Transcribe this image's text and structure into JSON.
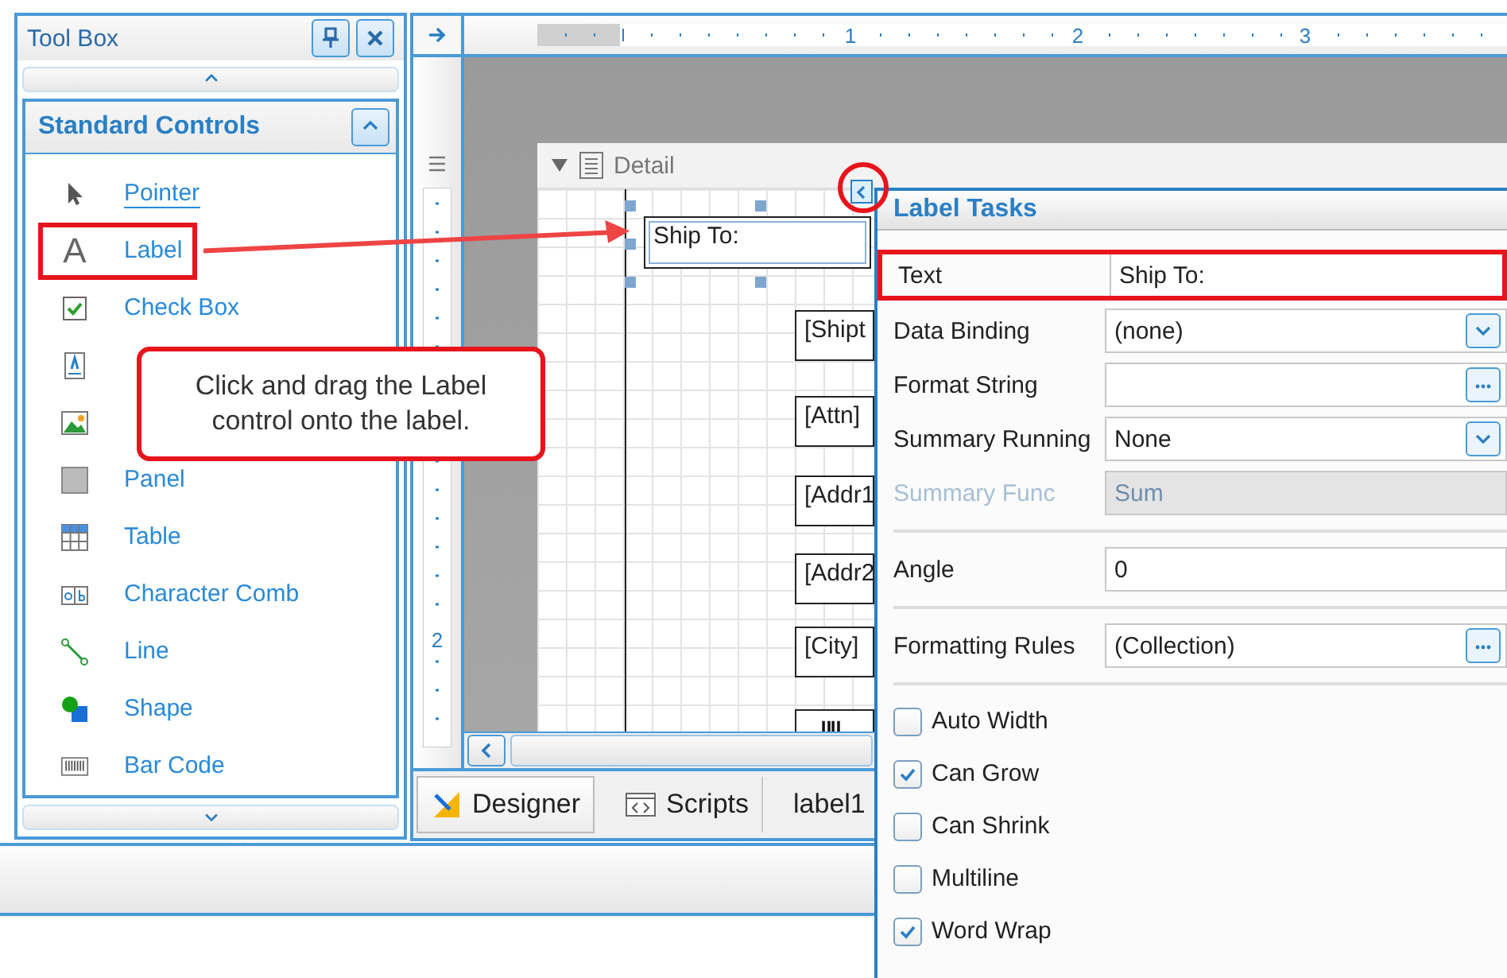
{
  "toolbox": {
    "title": "Tool Box",
    "group": {
      "title": "Standard Controls",
      "expanded": true,
      "items": [
        {
          "kind": "pointer",
          "label": "Pointer",
          "selected": true,
          "highlighted": false
        },
        {
          "kind": "label",
          "glyph": "A",
          "label": "Label",
          "selected": false,
          "highlighted": true
        },
        {
          "kind": "checkbox",
          "label": "Check Box",
          "selected": false,
          "highlighted": false
        },
        {
          "kind": "textbox"
        },
        {
          "kind": "picture"
        },
        {
          "kind": "panel",
          "label": "Panel",
          "selected": false,
          "highlighted": false
        },
        {
          "kind": "table",
          "label": "Table",
          "selected": false,
          "highlighted": false
        },
        {
          "kind": "charcomb",
          "label": "Character Comb",
          "selected": false,
          "highlighted": false
        },
        {
          "kind": "line",
          "label": "Line",
          "selected": false,
          "highlighted": false
        },
        {
          "kind": "shape",
          "label": "Shape",
          "selected": false,
          "highlighted": false
        },
        {
          "kind": "barcode",
          "label": "Bar Code",
          "selected": false,
          "highlighted": false
        }
      ]
    }
  },
  "callout": {
    "text": "Click and drag the Label control onto the label."
  },
  "designer": {
    "ruler": {
      "horizontal_marks": [
        "1",
        "2",
        "3"
      ],
      "vertical_marks": [
        "2"
      ]
    },
    "band": {
      "title": "Detail",
      "expanded": true,
      "controls": [
        {
          "kind": "label",
          "text": "Ship To:",
          "selected": true
        },
        {
          "kind": "field",
          "text": "[Shipt",
          "selected": false
        },
        {
          "kind": "field",
          "text": "[Attn]",
          "selected": false
        },
        {
          "kind": "field",
          "text": "[Addr1",
          "selected": false
        },
        {
          "kind": "field",
          "text": "[Addr2",
          "selected": false
        },
        {
          "kind": "field",
          "text": "[City]",
          "selected": false
        },
        {
          "kind": "barcode",
          "selected": false
        }
      ]
    },
    "tabs": [
      {
        "kind": "designer",
        "label": "Designer",
        "selected": true
      },
      {
        "kind": "scripts",
        "label": "Scripts",
        "selected": false
      },
      {
        "kind": "plain",
        "label": "label1",
        "selected": false
      }
    ]
  },
  "label_tasks": {
    "title": "Label Tasks",
    "groups": [
      [
        {
          "name": "Text",
          "value": "Ship To:",
          "kind": "text",
          "disabled": false,
          "highlighted": true
        },
        {
          "name": "Data Binding",
          "value": "(none)",
          "kind": "dropdown",
          "disabled": false,
          "highlighted": false
        },
        {
          "name": "Format String",
          "kind": "ellipsis",
          "disabled": false,
          "highlighted": false
        },
        {
          "name": "Summary Running",
          "value": "None",
          "kind": "dropdown",
          "disabled": false,
          "highlighted": false
        },
        {
          "name": "Summary Func",
          "value": "Sum",
          "kind": "text",
          "disabled": true,
          "highlighted": false
        }
      ],
      [
        {
          "name": "Angle",
          "value": "0",
          "kind": "text",
          "disabled": false,
          "highlighted": false
        }
      ],
      [
        {
          "name": "Formatting Rules",
          "value": "(Collection)",
          "kind": "ellipsis",
          "disabled": false,
          "highlighted": false
        }
      ]
    ],
    "options": [
      {
        "label": "Auto Width",
        "checked": false
      },
      {
        "label": "Can Grow",
        "checked": true
      },
      {
        "label": "Can Shrink",
        "checked": false
      },
      {
        "label": "Multiline",
        "checked": false
      },
      {
        "label": "Word Wrap",
        "checked": true
      }
    ]
  }
}
